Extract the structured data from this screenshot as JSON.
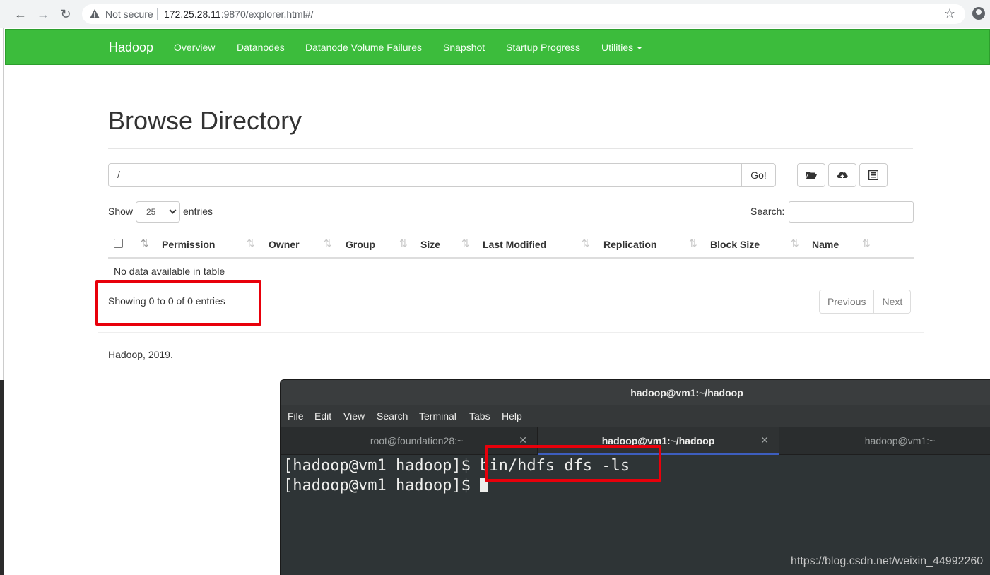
{
  "browser": {
    "security_label": "Not secure",
    "url_host": "172.25.28.11",
    "url_rest": ":9870/explorer.html#/"
  },
  "navbar": {
    "brand": "Hadoop",
    "links": [
      "Overview",
      "Datanodes",
      "Datanode Volume Failures",
      "Snapshot",
      "Startup Progress"
    ],
    "utilities": "Utilities"
  },
  "page": {
    "title": "Browse Directory",
    "path_value": "/",
    "go_label": "Go!",
    "show_label": "Show",
    "entries_value": "25",
    "entries_label": "entries",
    "search_label": "Search:",
    "no_data": "No data available in table",
    "showing": "Showing 0 to 0 of 0 entries",
    "prev_label": "Previous",
    "next_label": "Next",
    "footer": "Hadoop, 2019."
  },
  "table": {
    "columns": [
      "Permission",
      "Owner",
      "Group",
      "Size",
      "Last Modified",
      "Replication",
      "Block Size",
      "Name"
    ]
  },
  "terminal": {
    "title": "hadoop@vm1:~/hadoop",
    "menu": [
      "File",
      "Edit",
      "View",
      "Search",
      "Terminal",
      "Tabs",
      "Help"
    ],
    "tabs": [
      "root@foundation28:~",
      "hadoop@vm1:~/hadoop",
      "hadoop@vm1:~"
    ],
    "prompt": "[hadoop@vm1 hadoop]$ ",
    "command": "bin/hdfs dfs -ls"
  },
  "watermark": "https://blog.csdn.net/weixin_44992260",
  "colors": {
    "navbar": "#3cbc3c",
    "highlight": "#e8000b",
    "terminal_bg": "#2e3436"
  }
}
